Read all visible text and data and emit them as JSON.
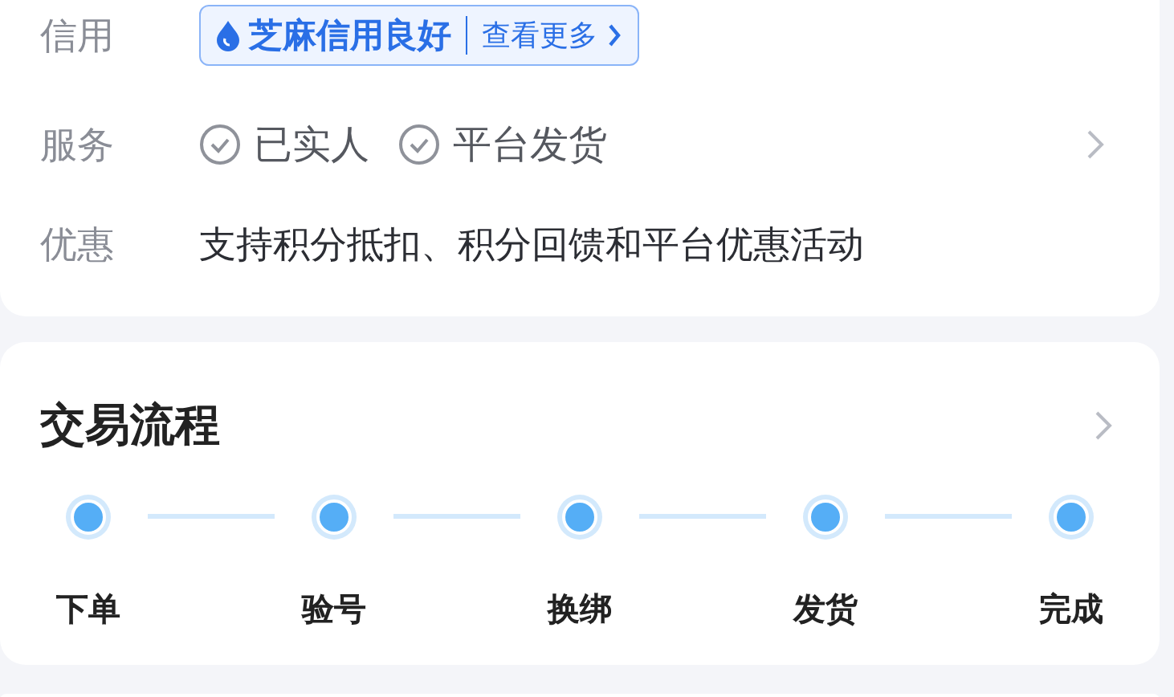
{
  "details": [
    {
      "kind": "credit",
      "label": "信用",
      "badge": {
        "rating": "芝麻信用良好",
        "link": "查看更多"
      }
    },
    {
      "kind": "services",
      "label": "服务",
      "items": [
        "已实人",
        "平台发货"
      ]
    },
    {
      "kind": "text",
      "label": "优惠",
      "text": "支持积分抵扣、积分回馈和平台优惠活动"
    }
  ],
  "process": {
    "title": "交易流程",
    "steps": [
      "下单",
      "验号",
      "换绑",
      "发货",
      "完成"
    ]
  }
}
